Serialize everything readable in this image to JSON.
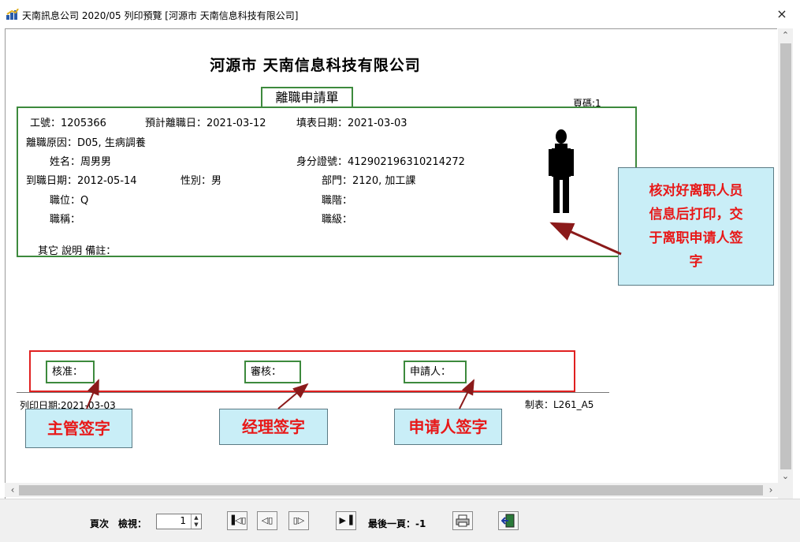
{
  "window": {
    "title": "天南訊息公司 2020/05 列印預覽 [河源市 天南信息科技有限公司]",
    "close_label": "×"
  },
  "report": {
    "company_name": "河源市 天南信息科技有限公司",
    "form_title": "離職申請單",
    "page_label": "頁碼:1",
    "fields": {
      "emp_no": "工號：1205366",
      "planned_leave": "預計離職日：2021-03-12",
      "fill_date": "填表日期：2021-03-03",
      "reason": "離職原因：D05, 生病調養",
      "name": "姓名：周男男",
      "id_no": "身分證號：412902196310214272",
      "hire_date": "到職日期：2012-05-14",
      "gender": "性別：男",
      "dept": "部門：2120, 加工課",
      "position": "職位：Q",
      "rank": "職階：",
      "title": "職稱：",
      "grade": "職級：",
      "remarks": "其它 說明 備註："
    },
    "signatures": {
      "approve": "核准：",
      "review": "審核：",
      "applicant": "申請人："
    },
    "print_date": "列印日期:2021-03-03",
    "form_code": "制表：L261_A5"
  },
  "annotations": {
    "main_note": [
      "核对好离职人员",
      "信息后打印，交",
      "于离职申请人签",
      "字"
    ],
    "supervisor": "主管签字",
    "manager": "经理签字",
    "applicant": "申请人签字"
  },
  "toolbar": {
    "page_label": "頁次",
    "view_label": "檢視：",
    "page_value": "1",
    "last_page_label": "最後一頁：-1",
    "first_icon": "first-page-icon",
    "prev_icon": "prev-page-icon",
    "next_icon": "next-page-icon",
    "last_icon": "last-page-icon",
    "print_icon": "printer-icon",
    "exit_icon": "exit-icon"
  },
  "colors": {
    "green_box": "#3d8a3d",
    "red_box": "#e02020",
    "callout_bg": "#c9eef7",
    "callout_text": "#e81818",
    "arrow": "#8b1a1a"
  }
}
